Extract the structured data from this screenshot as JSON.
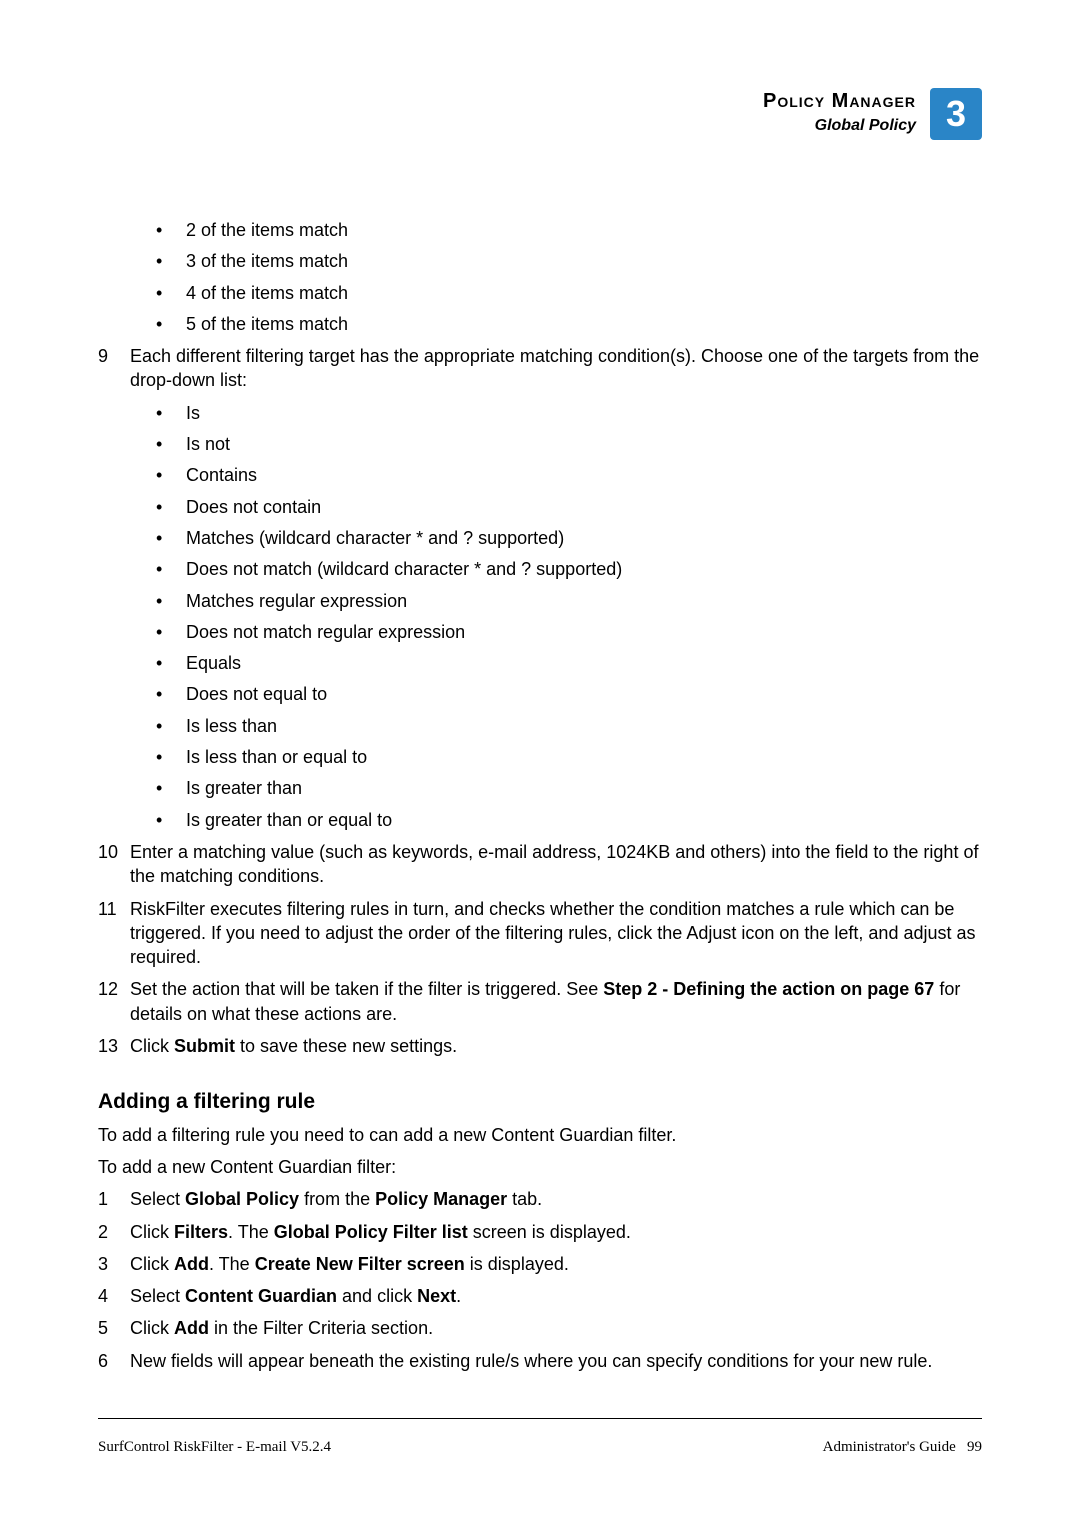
{
  "header": {
    "title": "Policy Manager",
    "subtitle": "Global Policy",
    "chapter": "3"
  },
  "bullets1": [
    "2 of the items match",
    "3 of the items match",
    "4 of the items match",
    "5 of the items match"
  ],
  "step9": {
    "num": "9",
    "text": "Each different filtering target has the appropriate matching condition(s). Choose one of the targets from the drop-down list:"
  },
  "bullets2": [
    "Is",
    "Is not",
    "Contains",
    "Does not contain",
    "Matches (wildcard character * and ? supported)",
    "Does not match (wildcard character * and ? supported)",
    "Matches regular expression",
    "Does not match regular expression",
    "Equals",
    "Does not equal to",
    "Is less than",
    "Is less than or equal to",
    "Is greater than",
    "Is greater than or equal to"
  ],
  "step10": {
    "num": "10",
    "text": "Enter a matching value (such as keywords, e-mail address, 1024KB and others) into the field to the right of the matching conditions."
  },
  "step11": {
    "num": "11",
    "text": "RiskFilter executes filtering rules in turn, and checks whether the condition matches a rule which can be triggered. If you need to adjust the order of the filtering rules, click the Adjust icon on the left, and adjust as required."
  },
  "step12": {
    "num": "12",
    "pre": "Set the action that will be taken if the filter is triggered. See ",
    "bold": "Step 2 - Defining the action on page 67",
    "post": " for details on what these actions are."
  },
  "step13": {
    "num": "13",
    "pre": "Click ",
    "bold": "Submit",
    "post": " to save these new settings."
  },
  "section": {
    "title": "Adding a filtering rule",
    "intro1": "To add a filtering rule you need to can add a new Content Guardian filter.",
    "intro2": "To add a new Content Guardian filter:"
  },
  "addSteps": {
    "s1": {
      "num": "1",
      "pre": "Select ",
      "b1": "Global Policy",
      "mid": " from the ",
      "b2": "Policy Manager",
      "post": " tab."
    },
    "s2": {
      "num": "2",
      "pre": "Click ",
      "b1": "Filters",
      "mid": ". The ",
      "b2": "Global Policy Filter list",
      "post": " screen is displayed."
    },
    "s3": {
      "num": "3",
      "pre": "Click ",
      "b1": "Add",
      "mid": ". The ",
      "b2": "Create New Filter screen",
      "post": " is displayed."
    },
    "s4": {
      "num": "4",
      "pre": "Select ",
      "b1": "Content Guardian",
      "mid": " and click ",
      "b2": "Next",
      "post": "."
    },
    "s5": {
      "num": "5",
      "pre": "Click ",
      "b1": "Add",
      "post": " in the Filter Criteria section."
    },
    "s6": {
      "num": "6",
      "text": "New fields will appear beneath the existing rule/s where you can specify conditions for your new rule."
    }
  },
  "footer": {
    "left": "SurfControl RiskFilter - E-mail V5.2.4",
    "rightLabel": "Administrator's Guide",
    "page": "99"
  }
}
